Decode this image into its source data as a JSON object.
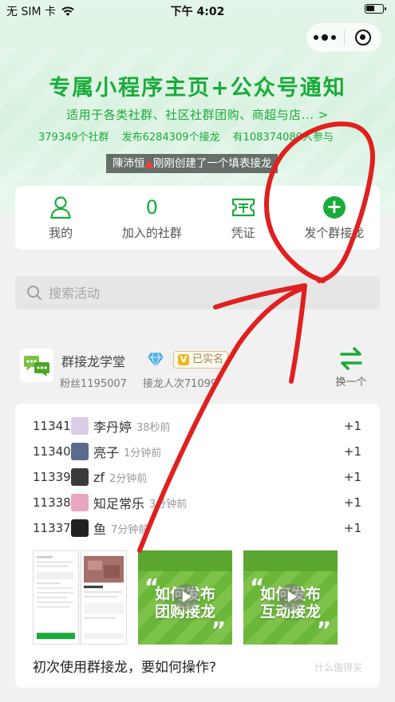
{
  "status_bar": {
    "carrier": "无 SIM 卡",
    "time": "下午 4:02"
  },
  "hero": {
    "title": "专属小程序主页+公众号通知",
    "subtitle": "适用于各类社群、社区社群团购、商超与店... >",
    "stats": [
      "379349个社群",
      "发布6284309个接龙",
      "有108374080人参与"
    ],
    "notice_user": "陳沛恒",
    "notice_text": "刚刚创建了一个填表接龙"
  },
  "nav": {
    "items": [
      {
        "label": "我的",
        "icon": "person-icon"
      },
      {
        "label": "加入的社群",
        "count": "0"
      },
      {
        "label": "凭证",
        "icon": "ticket-icon"
      },
      {
        "label": "发个群接龙",
        "icon": "plus-circle-icon"
      }
    ]
  },
  "search": {
    "placeholder": "搜索活动"
  },
  "profile": {
    "name": "群接龙学堂",
    "verified_label": "已实名",
    "fans": "粉丝1195007",
    "participations": "接龙人次71099",
    "switch_label": "换一个"
  },
  "feed": {
    "rows": [
      {
        "num": "11341.",
        "name": "李丹婷",
        "time": "38秒前",
        "plus": "+1",
        "avatar_color": "#d9cde8"
      },
      {
        "num": "11340.",
        "name": "亮子",
        "time": "1分钟前",
        "plus": "+1",
        "avatar_color": "#5a6b8c"
      },
      {
        "num": "11339.",
        "name": "zf",
        "time": "2分钟前",
        "plus": "+1",
        "avatar_color": "#3a3a3a"
      },
      {
        "num": "11338.",
        "name": "知足常乐",
        "time": "3分钟前",
        "plus": "+1",
        "avatar_color": "#e8a6c0"
      },
      {
        "num": "11337.",
        "name": "鱼",
        "time": "7分钟前",
        "plus": "+1",
        "avatar_color": "#222222"
      }
    ],
    "promo1": [
      "如何发布",
      "团购接龙"
    ],
    "promo2": [
      "如何发布",
      "互动接龙"
    ],
    "title": "初次使用群接龙，要如何操作?",
    "watermark": "什么值得买"
  },
  "colors": {
    "accent": "#1aab3a",
    "annotation": "#e02020"
  }
}
